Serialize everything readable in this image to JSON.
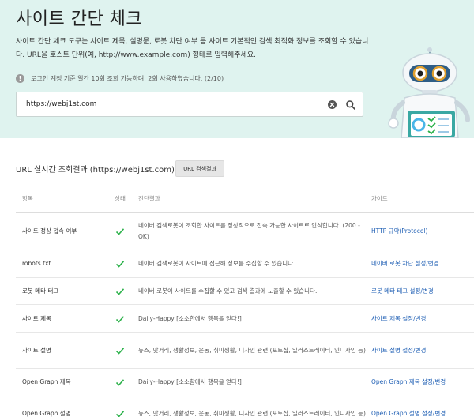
{
  "page": {
    "title": "사이트 간단 체크",
    "description": "사이트 간단 체크 도구는 사이트 제목, 설명문, 로봇 차단 여부 등 사이트 기본적인 검색 최적화 정보를 조회할 수 있습니다. URL을 호스트 단위(예, http://www.example.com) 형태로 입력해주세요.",
    "notice": "로그인 계정 기준 일간 10회 조회 가능하며, 2회 사용하였습니다. (2/10)",
    "notice_icon": "!"
  },
  "search": {
    "value": "https://webj1st.com",
    "placeholder": ""
  },
  "results": {
    "title": "URL 실시간 조회결과 (https://webj1st.com)",
    "button_label": "URL 검색결과",
    "columns": [
      "항목",
      "상태",
      "진단결과",
      "가이드"
    ],
    "rows": [
      {
        "item": "사이트 정상 접속 여부",
        "status": "check-icon",
        "result": "네이버 검색로봇이 조회한 사이트를 정상적으로 접속 가능한 사이트로 인식합니다. (200 - OK)",
        "guide": "HTTP 규약(Protocol)"
      },
      {
        "item": "robots.txt",
        "status": "check-icon",
        "result": "네이버 검색로봇이 사이트에 접근해 정보를 수집할 수 있습니다.",
        "guide": "네이버 로봇 차단 설정/변경"
      },
      {
        "item": "로봇 메타 태그",
        "status": "check-icon",
        "result": "네이버 로봇이 사이트를 수집할 수 있고 검색 결과에 노출할 수 있습니다.",
        "guide": "로봇 메타 태그 설정/변경"
      },
      {
        "item": "사이트 제목",
        "status": "check-icon",
        "result": "Daily-Happy [소소한에서 행복을 얻다!]",
        "guide": "사이트 제목 설정/변경"
      },
      {
        "item": "사이트 설명",
        "status": "check-icon",
        "result": "뉴스, 맛거리, 생활정보, 운동, 취미생활, 디자인 관련 (포토샵, 일러스트레이터, 인디자인 등)",
        "guide": "사이트 설명 설정/변경"
      },
      {
        "item": "Open Graph 제목",
        "status": "check-icon",
        "result": "Daily-Happy [소소함에서 행복을 얻다!]",
        "guide": "Open Graph 제목 설정/변경"
      },
      {
        "item": "Open Graph 설명",
        "status": "check-icon",
        "result": "뉴스, 맛거리, 생활정보, 운동, 취미생활, 디자인 관련 (포토샵, 일러스트레이터, 인디자인 등)",
        "guide": "Open Graph 설명 설정/변경"
      }
    ]
  },
  "colors": {
    "hero_bg": "#dff3ef",
    "check": "#2db24b",
    "link": "#1f5fb4"
  }
}
